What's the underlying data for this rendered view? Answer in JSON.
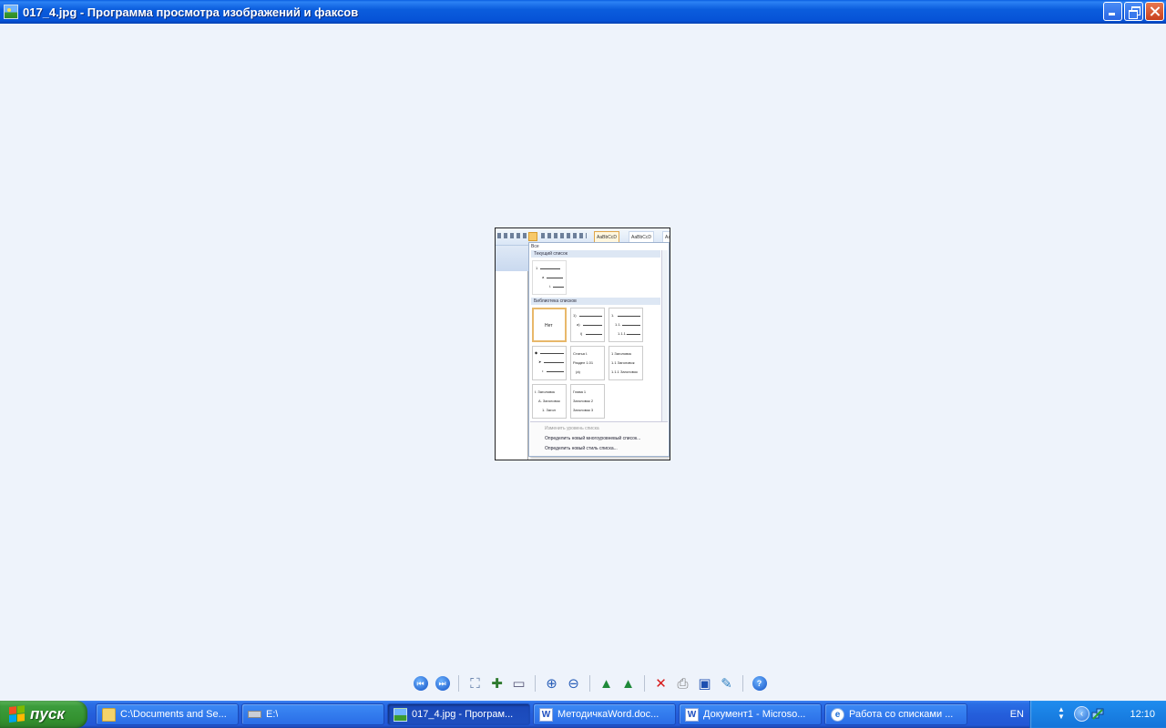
{
  "window": {
    "title": "017_4.jpg - Программа просмотра изображений и факсов"
  },
  "picture": {
    "ribbon_styles": [
      "AaBbCcD",
      "AaBbCcD",
      "Aa"
    ],
    "menu_title": "Все",
    "section_current": "Текущий список",
    "section_library": "Библиотека списков",
    "none_label": "Нет",
    "cell2_lines": [
      "1)",
      "a)",
      "i)"
    ],
    "cell3_lines": [
      "1.",
      "1.1.",
      "1.1.1."
    ],
    "cell4_lines": [
      "◆",
      "➤",
      "•"
    ],
    "cell5_lines": [
      "Статья I.",
      "Раздел 1.01",
      "(a)"
    ],
    "cell6_lines": [
      "1 Заголовок",
      "1.1 Заголовок",
      "1.1.1 Заголовок"
    ],
    "cell7_lines": [
      "I. Заголовок",
      "A. Заголовок",
      "1. Загол"
    ],
    "cell8_lines": [
      "Глава 1",
      "Заголовок 2",
      "Заголовок 3"
    ],
    "menu_items": [
      "Изменить уровень списка",
      "Определить новый многоуровневый список...",
      "Определить новый стиль списка..."
    ]
  },
  "toolbar": {
    "items": [
      {
        "name": "prev-image-button",
        "icon": "prev-icon"
      },
      {
        "name": "next-image-button",
        "icon": "next-icon"
      },
      {
        "name": "best-fit-button",
        "icon": "best-fit-icon"
      },
      {
        "name": "actual-size-button",
        "icon": "actual-size-icon"
      },
      {
        "name": "slideshow-button",
        "icon": "slideshow-icon"
      },
      {
        "name": "zoom-in-button",
        "icon": "zoom-in-icon"
      },
      {
        "name": "zoom-out-button",
        "icon": "zoom-out-icon"
      },
      {
        "name": "rotate-cw-button",
        "icon": "rotate-clockwise-icon"
      },
      {
        "name": "rotate-ccw-button",
        "icon": "rotate-counterclockwise-icon"
      },
      {
        "name": "delete-button",
        "icon": "delete-icon"
      },
      {
        "name": "print-button",
        "icon": "print-icon"
      },
      {
        "name": "save-button",
        "icon": "save-icon"
      },
      {
        "name": "edit-button",
        "icon": "edit-icon"
      },
      {
        "name": "help-button",
        "icon": "help-icon"
      }
    ]
  },
  "taskbar": {
    "start_label": "пуск",
    "tasks": [
      {
        "label": "C:\\Documents and Se...",
        "icon": "folder-icon",
        "active": false
      },
      {
        "label": "E:\\",
        "icon": "drive-icon",
        "active": false
      },
      {
        "label": "017_4.jpg - Програм...",
        "icon": "image-viewer-icon",
        "active": true
      },
      {
        "label": "МетодичкаWord.doc...",
        "icon": "word-icon",
        "active": false
      },
      {
        "label": "Документ1 - Microso...",
        "icon": "word-icon",
        "active": false
      },
      {
        "label": "Работа со списками ...",
        "icon": "ie-icon",
        "active": false
      }
    ],
    "language": "EN",
    "clock": "12:10"
  }
}
